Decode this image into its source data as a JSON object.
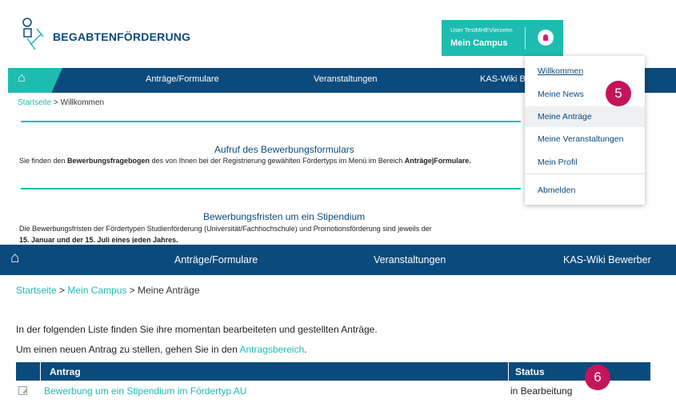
{
  "top_panel": {
    "brand": "BEGABTENFÖRDERUNG",
    "campus": {
      "user": "User TestMHEVierzehn",
      "title": "Mein Campus"
    },
    "nav": {
      "items": [
        "Anträge/Formulare",
        "Veranstaltungen",
        "KAS-Wiki Be"
      ]
    },
    "breadcrumb": {
      "home": "Startseite",
      "sep": ">",
      "current": "Willkommen"
    },
    "section1": {
      "heading": "Aufruf des Bewerbungsformulars",
      "text_a": "Sie finden den ",
      "text_b": "Bewerbungsfragebogen",
      "text_c": " des von Ihnen bei der Registrierung gewählten Fördertyps im Menü im Bereich ",
      "text_d": "Anträge|Formulare."
    },
    "section2": {
      "heading": "Bewerbungsfristen um ein Stipendium",
      "text_a": "Die Bewerbungsfristen der Fördertypen Studienförderung (Universität/Fachhochschule) und Promotionsförderung sind jeweils der",
      "text_b": "15. Januar und der 15. Juli eines jeden Jahres."
    },
    "dropdown": {
      "items": [
        "Willkommen",
        "Meine News",
        "Meine Anträge",
        "Meine Veranstaltungen",
        "Mein Profil",
        "Abmelden"
      ]
    },
    "badge": "5"
  },
  "bottom_panel": {
    "nav": {
      "items": [
        "Anträge/Formulare",
        "Veranstaltungen",
        "KAS-Wiki Bewerber"
      ]
    },
    "breadcrumb": {
      "home": "Startseite",
      "sep1": ">",
      "campus": "Mein Campus",
      "sep2": ">",
      "current": "Meine Anträge"
    },
    "intro": "In der folgenden Liste finden Sie ihre momentan bearbeiteten und gestellten Anträge.",
    "new_prefix": "Um einen neuen Antrag zu stellen, gehen Sie in den ",
    "new_link": "Antragsbereich",
    "new_suffix": ".",
    "table": {
      "headers": [
        "Antrag",
        "Status"
      ],
      "rows": [
        {
          "antrag": "Bewerbung um ein Stipendium im Fördertyp AU",
          "status": "in Bearbeitung"
        }
      ]
    },
    "badge": "6"
  },
  "colors": {
    "navy": "#0b4a7c",
    "teal": "#1ebcb0",
    "badge": "#c4145b"
  }
}
